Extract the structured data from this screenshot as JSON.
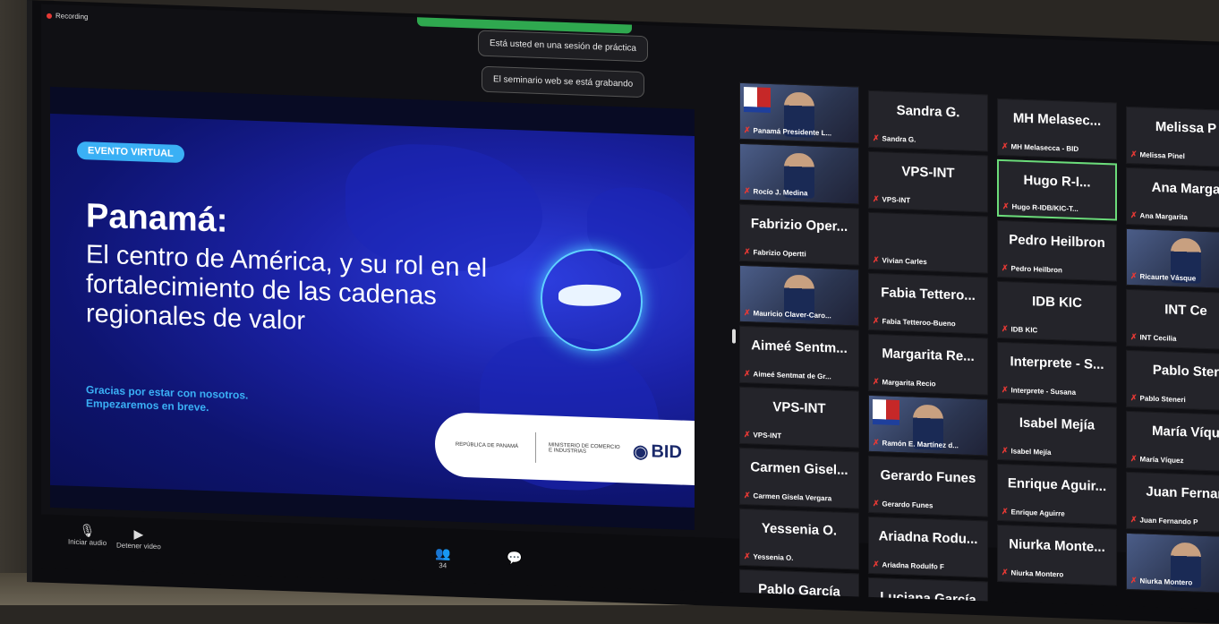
{
  "recording_label": "Recording",
  "toasts": [
    "Está usted en una sesión de práctica",
    "El seminario web se está grabando"
  ],
  "slide": {
    "tag": "EVENTO VIRTUAL",
    "title": "Panamá:",
    "subtitle": "El centro de América, y su rol en el fortalecimiento de las cadenas regionales de valor",
    "thanks": "Gracias por estar con nosotros. Empezaremos en breve.",
    "logo_republic": "REPÚBLICA DE PANAMÁ",
    "logo_ministry": "MINISTERIO DE COMERCIO E INDUSTRIAS",
    "logo_bid": "BID"
  },
  "toolbar": {
    "participants_count": "34",
    "unmute": "Iniciar audio",
    "video": "Detener video",
    "participants": "Participantes"
  },
  "participants": [
    {
      "big": "",
      "small": "Panamá Presidente L..."
    },
    {
      "big": "Sandra G.",
      "small": "Sandra G."
    },
    {
      "big": "MH Melasec...",
      "small": "MH Melasecca - BID"
    },
    {
      "big": "Melissa P",
      "small": "Melissa Pinel"
    },
    {
      "big": "",
      "small": "Rocío J. Medina"
    },
    {
      "big": "VPS-INT",
      "small": "VPS-INT"
    },
    {
      "big": "Hugo R-I...",
      "small": "Hugo R-IDB/KIC-T..."
    },
    {
      "big": "Ana Marga",
      "small": "Ana Margarita"
    },
    {
      "big": "Fabrizio Oper...",
      "small": "Fabrizio Opertti"
    },
    {
      "big": "",
      "small": "Vivian Carles"
    },
    {
      "big": "Pedro Heilbron",
      "small": "Pedro Heilbron"
    },
    {
      "big": "",
      "small": "Ricaurte Vásque"
    },
    {
      "big": "",
      "small": "Mauricio Claver-Caro..."
    },
    {
      "big": "Fabia Tettero...",
      "small": "Fabia Tetteroo-Bueno"
    },
    {
      "big": "IDB KIC",
      "small": "IDB KIC"
    },
    {
      "big": "INT Ce",
      "small": "INT Cecilia"
    },
    {
      "big": "Aimeé Sentm...",
      "small": "Aimeé Sentmat de Gr..."
    },
    {
      "big": "Margarita Re...",
      "small": "Margarita Recio"
    },
    {
      "big": "Interprete - S...",
      "small": "Interprete - Susana"
    },
    {
      "big": "Pablo Ster",
      "small": "Pablo Steneri"
    },
    {
      "big": "VPS-INT",
      "small": "VPS-INT"
    },
    {
      "big": "",
      "small": "Ramón E. Martínez d..."
    },
    {
      "big": "Isabel Mejía",
      "small": "Isabel Mejía"
    },
    {
      "big": "María Víqu",
      "small": "María Víquez"
    },
    {
      "big": "Carmen Gisel...",
      "small": "Carmen Gisela Vergara"
    },
    {
      "big": "Gerardo Funes",
      "small": "Gerardo Funes"
    },
    {
      "big": "Enrique Aguir...",
      "small": "Enrique Aguirre"
    },
    {
      "big": "Juan Fernan",
      "small": "Juan Fernando P"
    },
    {
      "big": "Yessenia O.",
      "small": "Yessenia O."
    },
    {
      "big": "Ariadna Rodu...",
      "small": "Ariadna Rodulfo F"
    },
    {
      "big": "Niurka Monte...",
      "small": "Niurka Montero"
    },
    {
      "big": "",
      "small": "Niurka Montero"
    },
    {
      "big": "Pablo García",
      "small": "Pablo García"
    },
    {
      "big": "Luciana García",
      "small": ""
    }
  ]
}
